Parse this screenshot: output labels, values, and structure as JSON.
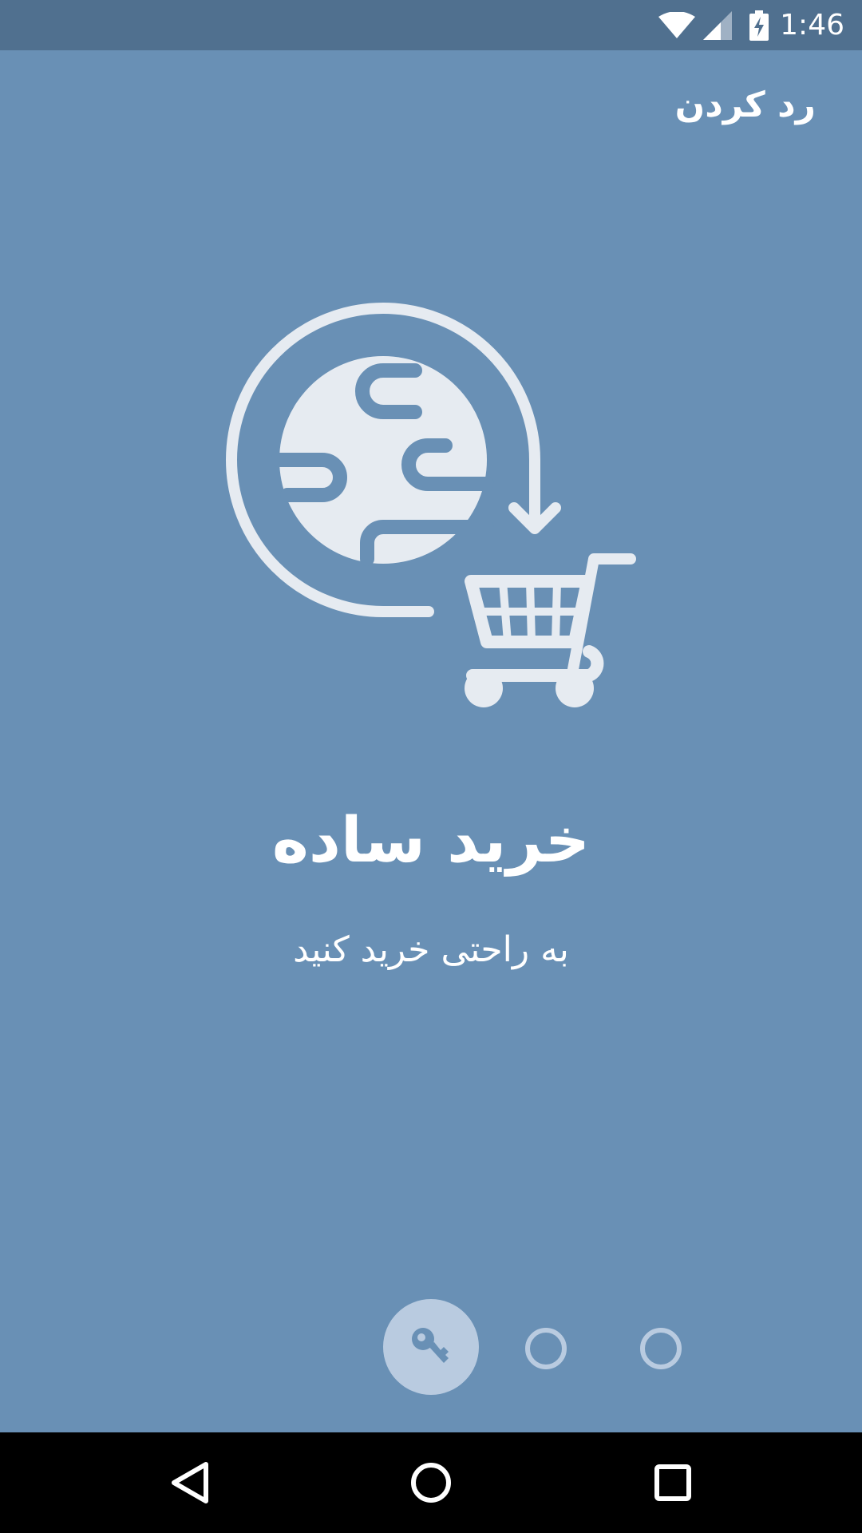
{
  "status_bar": {
    "time": "1:46",
    "icons": [
      "wifi-icon",
      "cell-signal-icon",
      "battery-charging-icon"
    ]
  },
  "header": {
    "skip_label": "رد کردن"
  },
  "slide": {
    "illustration": "global-shopping-cart-icon",
    "title": "خرید ساده",
    "subtitle": "به راحتی خرید کنید"
  },
  "pager": {
    "active_icon": "key-icon",
    "current_page": 1,
    "total_pages": 3
  },
  "nav_bar": {
    "buttons": [
      "back-icon",
      "home-icon",
      "recents-icon"
    ]
  },
  "colors": {
    "background": "#6990b5",
    "status_bar": "#50708f",
    "icon_light": "#e6ebf1",
    "indicator": "#b9cbe0"
  }
}
